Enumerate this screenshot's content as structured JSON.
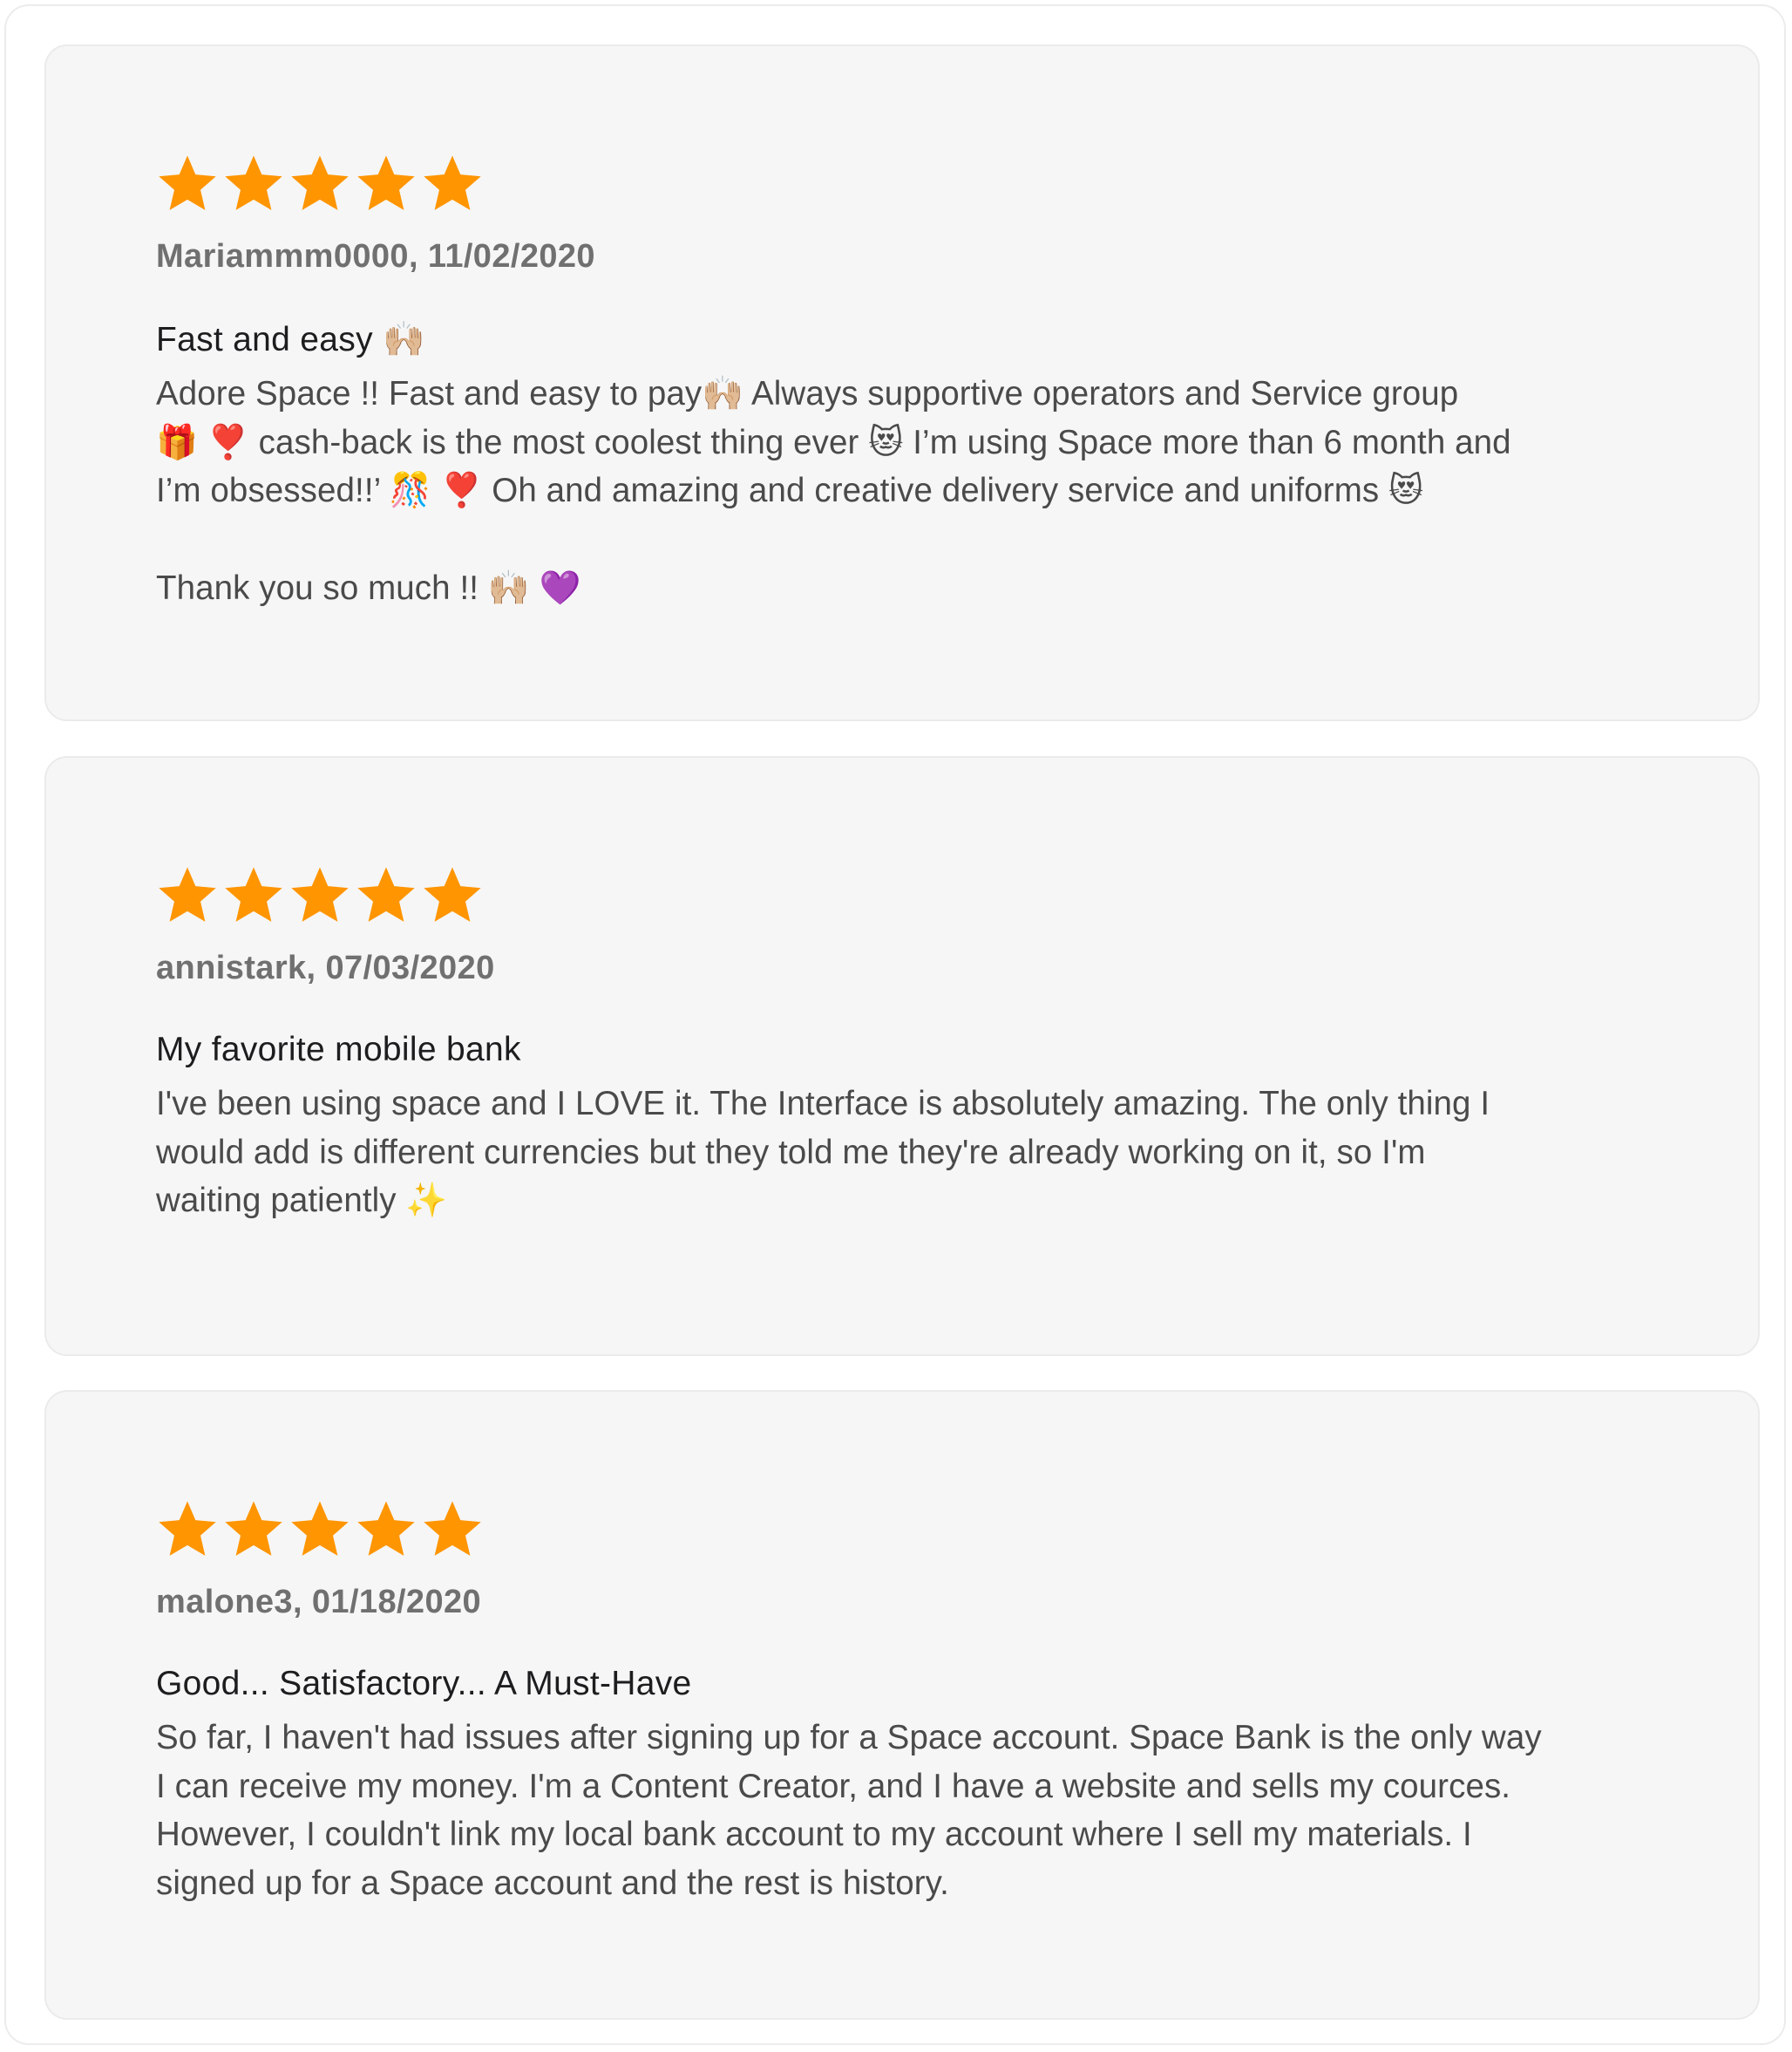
{
  "colors": {
    "star": "#ff9500",
    "card_bg": "#f6f6f6",
    "meta": "#707070",
    "title": "#1d1d1f",
    "body": "#4a4a4a"
  },
  "reviews": [
    {
      "rating": 5,
      "meta": "Mariammm0000, 11/02/2020",
      "title": "Fast and easy 🙌🏼",
      "body": [
        "Adore Space !! Fast and easy to pay🙌🏼 Always supportive operators and Service group",
        "🎁 ❣️ cash-back is the most coolest thing ever 😻 I’m using Space more than 6 month and",
        "I’m obsessed!!’ 🎊 ❣️ Oh and amazing and creative delivery service and uniforms 😻"
      ],
      "footer": "Thank you so much !! 🙌🏼 💜"
    },
    {
      "rating": 5,
      "meta": "annistark, 07/03/2020",
      "title": "My favorite mobile bank",
      "body": [
        "I've been using space and I LOVE it. The Interface is absolutely amazing. The only thing I",
        "would add is different currencies but they told me they're already working on it, so I'm",
        "waiting patiently ✨"
      ]
    },
    {
      "rating": 5,
      "meta": "malone3, 01/18/2020",
      "title": "Good... Satisfactory... A Must-Have",
      "body": [
        "So far, I haven't had issues after signing up for a Space account. Space Bank is the only way",
        "I can receive my money. I'm a Content Creator, and I have a website and sells my cources.",
        "However, I couldn't link my local bank account to my account where I sell my materials. I",
        "signed up for a Space account and the rest is history."
      ]
    }
  ]
}
